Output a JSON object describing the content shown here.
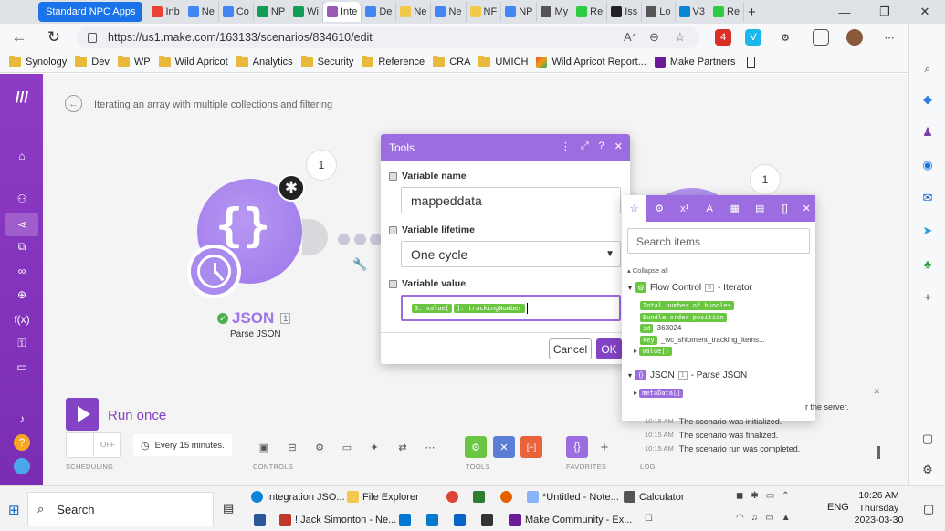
{
  "browser": {
    "tabs": [
      {
        "label": "Standard NPC Apps",
        "pinned": true
      },
      {
        "label": "Inb",
        "icon": "gmail-icon",
        "color": "#ea4335"
      },
      {
        "label": "Ne",
        "icon": "calendar-icon",
        "color": "#4285f4"
      },
      {
        "label": "Co",
        "icon": "docs-icon",
        "color": "#4285f4"
      },
      {
        "label": "NP",
        "icon": "sheets-icon",
        "color": "#0f9d58"
      },
      {
        "label": "Wi",
        "icon": "sheets-icon",
        "color": "#0f9d58"
      },
      {
        "label": "Inte",
        "icon": "make-icon",
        "active": true,
        "color": "#9b59b6"
      },
      {
        "label": "De",
        "icon": "docs-icon",
        "color": "#4285f4"
      },
      {
        "label": "Ne",
        "icon": "page-icon",
        "color": "#f2c94c"
      },
      {
        "label": "Ne",
        "icon": "docs-icon",
        "color": "#4285f4"
      },
      {
        "label": "NF",
        "icon": "page-icon",
        "color": "#f2c94c"
      },
      {
        "label": "NP",
        "icon": "docs-icon",
        "color": "#4285f4"
      },
      {
        "label": "My",
        "icon": "wordpress-icon",
        "color": "#555"
      },
      {
        "label": "Re",
        "icon": "leaf-icon",
        "color": "#2ecc40"
      },
      {
        "label": "Iss",
        "icon": "github-icon",
        "color": "#222"
      },
      {
        "label": "Lo",
        "icon": "wordpress-icon",
        "color": "#555"
      },
      {
        "label": "V3",
        "icon": "edge-icon",
        "color": "#0a84d6"
      },
      {
        "label": "Re",
        "icon": "leaf-icon",
        "color": "#2ecc40"
      }
    ],
    "new_tab": "+",
    "window_controls": [
      "—",
      "❐",
      "✕"
    ],
    "url": "https://us1.make.com/163133/scenarios/834610/edit",
    "badge_count": "4",
    "bookmarks": [
      "Synology",
      "Dev",
      "WP",
      "Wild Apricot",
      "Analytics",
      "Security",
      "Reference",
      "CRA",
      "UMICH",
      "Wild Apricot Report...",
      "Make Partners"
    ]
  },
  "scenario": {
    "title": "Iterating an array with multiple collections and filtering",
    "json_module": {
      "name": "JSON",
      "number": "1",
      "subtitle": "Parse JSON",
      "bubble": "1"
    },
    "iterator_bubble": "1"
  },
  "tools_dialog": {
    "title": "Tools",
    "variable_name_label": "Variable name",
    "variable_name_value": "mappeddata",
    "lifetime_label": "Variable lifetime",
    "lifetime_value": "One cycle",
    "value_label": "Variable value",
    "value_chip_1": "3. value[",
    "value_chip_2": "]: trackingNumber",
    "cancel": "Cancel",
    "ok": "OK"
  },
  "mapper": {
    "search_placeholder": "Search items",
    "collapse_all": "Collapse all",
    "flow_control": {
      "name": "Flow Control",
      "number": "3",
      "suffix": "- Iterator"
    },
    "items": [
      {
        "key": "Total number of bundles",
        "value": ""
      },
      {
        "key": "Bundle order position",
        "value": ""
      },
      {
        "key": "id",
        "value": "363024"
      },
      {
        "key": "key",
        "value": "_wc_shipment_tracking_items..."
      },
      {
        "key": "value[]",
        "value": ""
      }
    ],
    "json": {
      "name": "JSON",
      "number": "1",
      "suffix": "- Parse JSON"
    },
    "json_items": [
      "metaData[]"
    ]
  },
  "bottom_bar": {
    "run_once": "Run once",
    "toggle": "OFF",
    "schedule": "Every 15 minutes.",
    "groups": [
      "SCHEDULING",
      "CONTROLS",
      "TOOLS",
      "FAVORITES",
      "LOG"
    ]
  },
  "log": {
    "partial": "r the server.",
    "rows": [
      {
        "time": "10:15 AM",
        "text": "The scenario was initialized."
      },
      {
        "time": "10:15 AM",
        "text": "The scenario was finalized."
      },
      {
        "time": "10:15 AM",
        "text": "The scenario run was completed."
      }
    ]
  },
  "taskbar": {
    "search": "Search",
    "row1": [
      "Integration JSO...",
      "File Explorer",
      "*Untitled - Note...",
      "Calculator"
    ],
    "row2": [
      "! Jack Simonton - Ne...",
      "Make Community - Ex..."
    ],
    "lang": "ENG",
    "time": "10:26 AM",
    "day": "Thursday",
    "date": "2023-03-30"
  }
}
